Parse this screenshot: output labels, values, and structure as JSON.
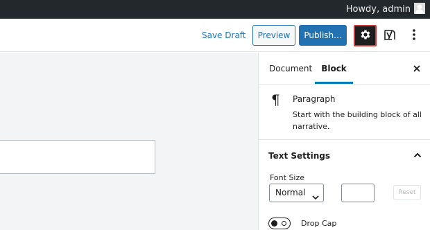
{
  "adminbar": {
    "greeting": "Howdy, admin",
    "avatar_icon": "user-avatar-icon"
  },
  "toolbar": {
    "save_draft": "Save Draft",
    "preview": "Preview",
    "publish": "Publish...",
    "settings_icon": "gear-icon",
    "yoast_icon": "yoast-icon",
    "more_icon": "vertical-ellipsis-icon",
    "accent_color": "#2271b1",
    "highlight_color": "#d63638"
  },
  "sidebar": {
    "tabs": [
      {
        "label": "Document",
        "active": false
      },
      {
        "label": "Block",
        "active": true
      }
    ],
    "close_icon": "close-icon",
    "block": {
      "icon": "paragraph-icon",
      "symbol": "¶",
      "title": "Paragraph",
      "description": "Start with the building block of all narrative."
    },
    "text_settings": {
      "title": "Text Settings",
      "expanded": true,
      "font_size_label": "Font Size",
      "font_size_value": "Normal",
      "custom_size_value": "",
      "reset_label": "Reset",
      "drop_cap_label": "Drop Cap",
      "drop_cap_enabled": false
    }
  }
}
